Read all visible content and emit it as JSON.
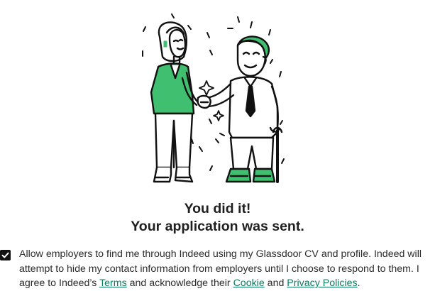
{
  "illustration": {
    "icon": "handshake-illustration",
    "accent_color": "#3fbf6f"
  },
  "headline": {
    "line1": "You did it!",
    "line2": "Your application was sent."
  },
  "consent": {
    "checked": true,
    "text_before": "Allow employers to find me through Indeed using my Glassdoor CV and profile. Indeed will attempt to hide my contact information from employers until I choose to respond to them. I agree to Indeed’s ",
    "terms_link": "Terms",
    "text_middle": " and acknowledge their ",
    "cookie_link": "Cookie",
    "text_and": " and ",
    "privacy_link": "Privacy Policies",
    "text_end": "."
  }
}
